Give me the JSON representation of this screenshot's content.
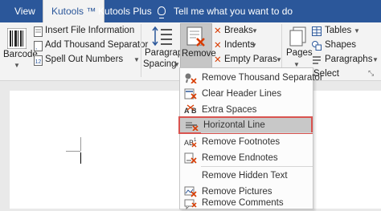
{
  "tabs": [
    {
      "label": "View"
    },
    {
      "label": "Kutools ™"
    },
    {
      "label": "Kutools Plus"
    }
  ],
  "tell_me": "Tell me what you want to do",
  "ribbon": {
    "barcode": "Barcode",
    "insert_file_info": "Insert File Information",
    "add_thousand_sep": "Add Thousand Separator",
    "spell_out_numbers": "Spell Out Numbers",
    "paragraph": "Paragraph",
    "spacing": "Spacing",
    "remove": "Remove",
    "breaks": "Breaks",
    "indents": "Indents",
    "empty_paras": "Empty Paras",
    "pages": "Pages",
    "tables": "Tables",
    "shapes": "Shapes",
    "paragraphs": "Paragraphs",
    "select": "Select"
  },
  "menu": {
    "items": [
      {
        "label": "Remove Thousand Separator",
        "icon": "thousand-separator-icon"
      },
      {
        "label": "Clear Header Lines",
        "icon": "header-lines-icon"
      },
      {
        "label": "Extra Spaces",
        "icon": "extra-spaces-icon"
      },
      {
        "label": "Horizontal Line",
        "icon": "horizontal-line-icon"
      },
      {
        "label": "Remove Footnotes",
        "icon": "footnotes-icon"
      },
      {
        "label": "Remove Endnotes",
        "icon": "endnotes-icon"
      },
      {
        "label": "Remove Hidden Text",
        "icon": "hidden-text-icon"
      },
      {
        "label": "Remove Pictures",
        "icon": "pictures-icon"
      },
      {
        "label": "Remove Comments",
        "icon": "comments-icon"
      }
    ]
  },
  "colors": {
    "tab_bar": "#2b579a",
    "ribbon": "#f3f3f3",
    "highlight_border": "#d9534f",
    "highlight_fill": "#c8c8c8",
    "remove_x": "#d83b01"
  }
}
